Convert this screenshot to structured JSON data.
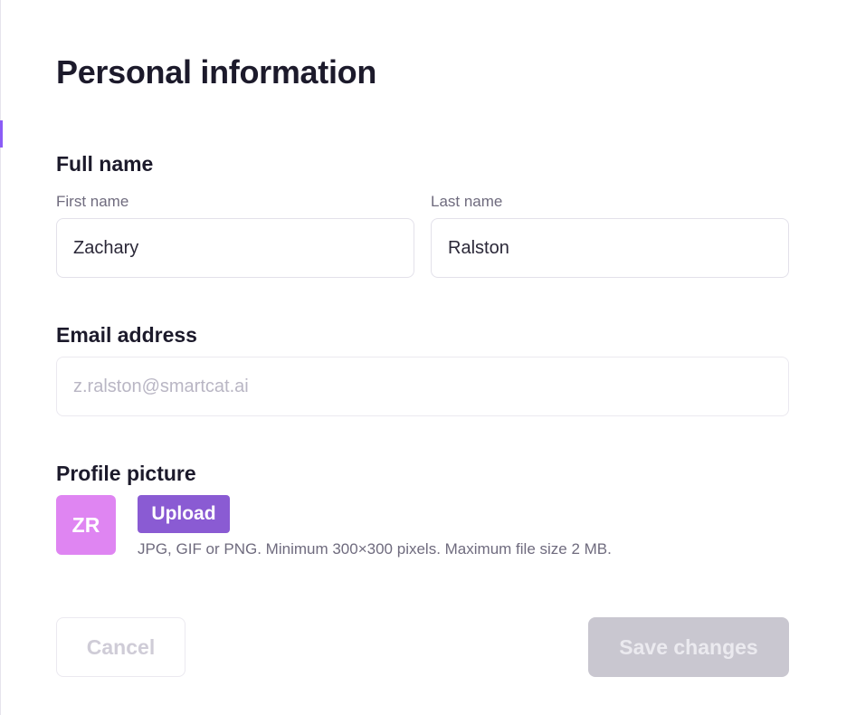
{
  "page": {
    "title": "Personal information"
  },
  "full_name": {
    "section_title": "Full name",
    "first_name": {
      "label": "First name",
      "value": "Zachary"
    },
    "last_name": {
      "label": "Last name",
      "value": "Ralston"
    }
  },
  "email": {
    "section_title": "Email address",
    "value": "z.ralston@smartcat.ai"
  },
  "profile_picture": {
    "section_title": "Profile picture",
    "avatar_initials": "ZR",
    "avatar_color": "#df85f2",
    "upload_label": "Upload",
    "upload_color": "#8a5bd3",
    "hint": "JPG, GIF or PNG. Minimum 300×300 pixels. Maximum file size 2 MB."
  },
  "actions": {
    "cancel_label": "Cancel",
    "save_label": "Save changes"
  }
}
